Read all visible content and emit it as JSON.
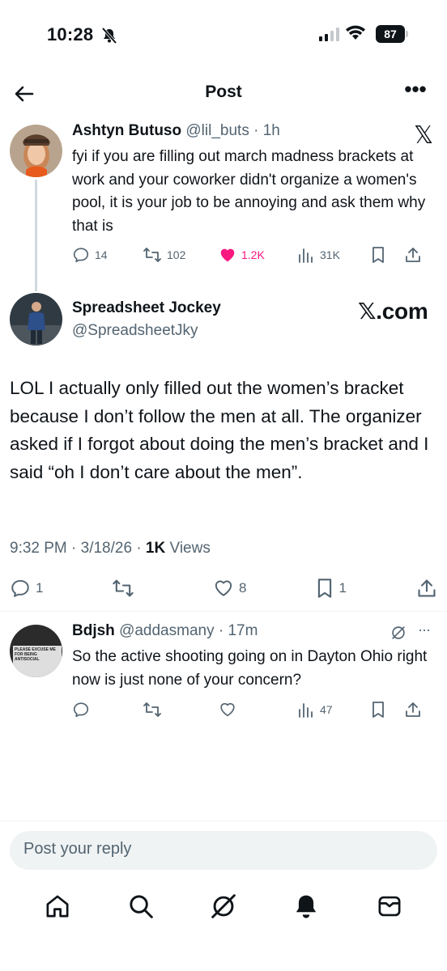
{
  "status_bar": {
    "time": "10:28",
    "battery": "87"
  },
  "header": {
    "title": "Post",
    "more": "•••"
  },
  "quoted_post": {
    "author_name": "Ashtyn Butuso",
    "handle_time": "@lil_buts · 1h",
    "text": "fyi if you are filling out march madness brackets at work and your coworker didn't organize a women's pool, it is your job to be annoying and ask them why that is",
    "brand": "𝕏",
    "replies": "14",
    "reposts": "102",
    "likes": "1.2K",
    "views": "31K",
    "like_color": "#f91880"
  },
  "main_post": {
    "author_name": "Spreadsheet Jockey",
    "handle": "@SpreadsheetJky",
    "watermark": "𝕏.com",
    "text": "LOL I actually only filled out the women’s bracket because I don’t follow the men at all. The organizer asked if I forgot about doing the men’s bracket and I said “oh I don’t care about the men”.",
    "timestamp": "9:32 PM · 3/18/26 · ",
    "views_count": "1K",
    "views_label": " Views",
    "replies": "1",
    "likes": "8",
    "bookmarks": "1"
  },
  "reply_post": {
    "author_name": "Bdjsh",
    "handle_time": "@addasmany · 17m",
    "avatar_text": "PLEASE EXCUSE ME FOR BEING ANTISOCIAL",
    "text": "So the active shooting going on in Dayton Ohio right now is just none of your concern?",
    "views": "47",
    "more": "···"
  },
  "composer": {
    "placeholder": "Post your reply"
  },
  "nav": {
    "items": [
      "home-icon",
      "search-icon",
      "grok-icon",
      "notifications-icon",
      "messages-icon"
    ]
  }
}
